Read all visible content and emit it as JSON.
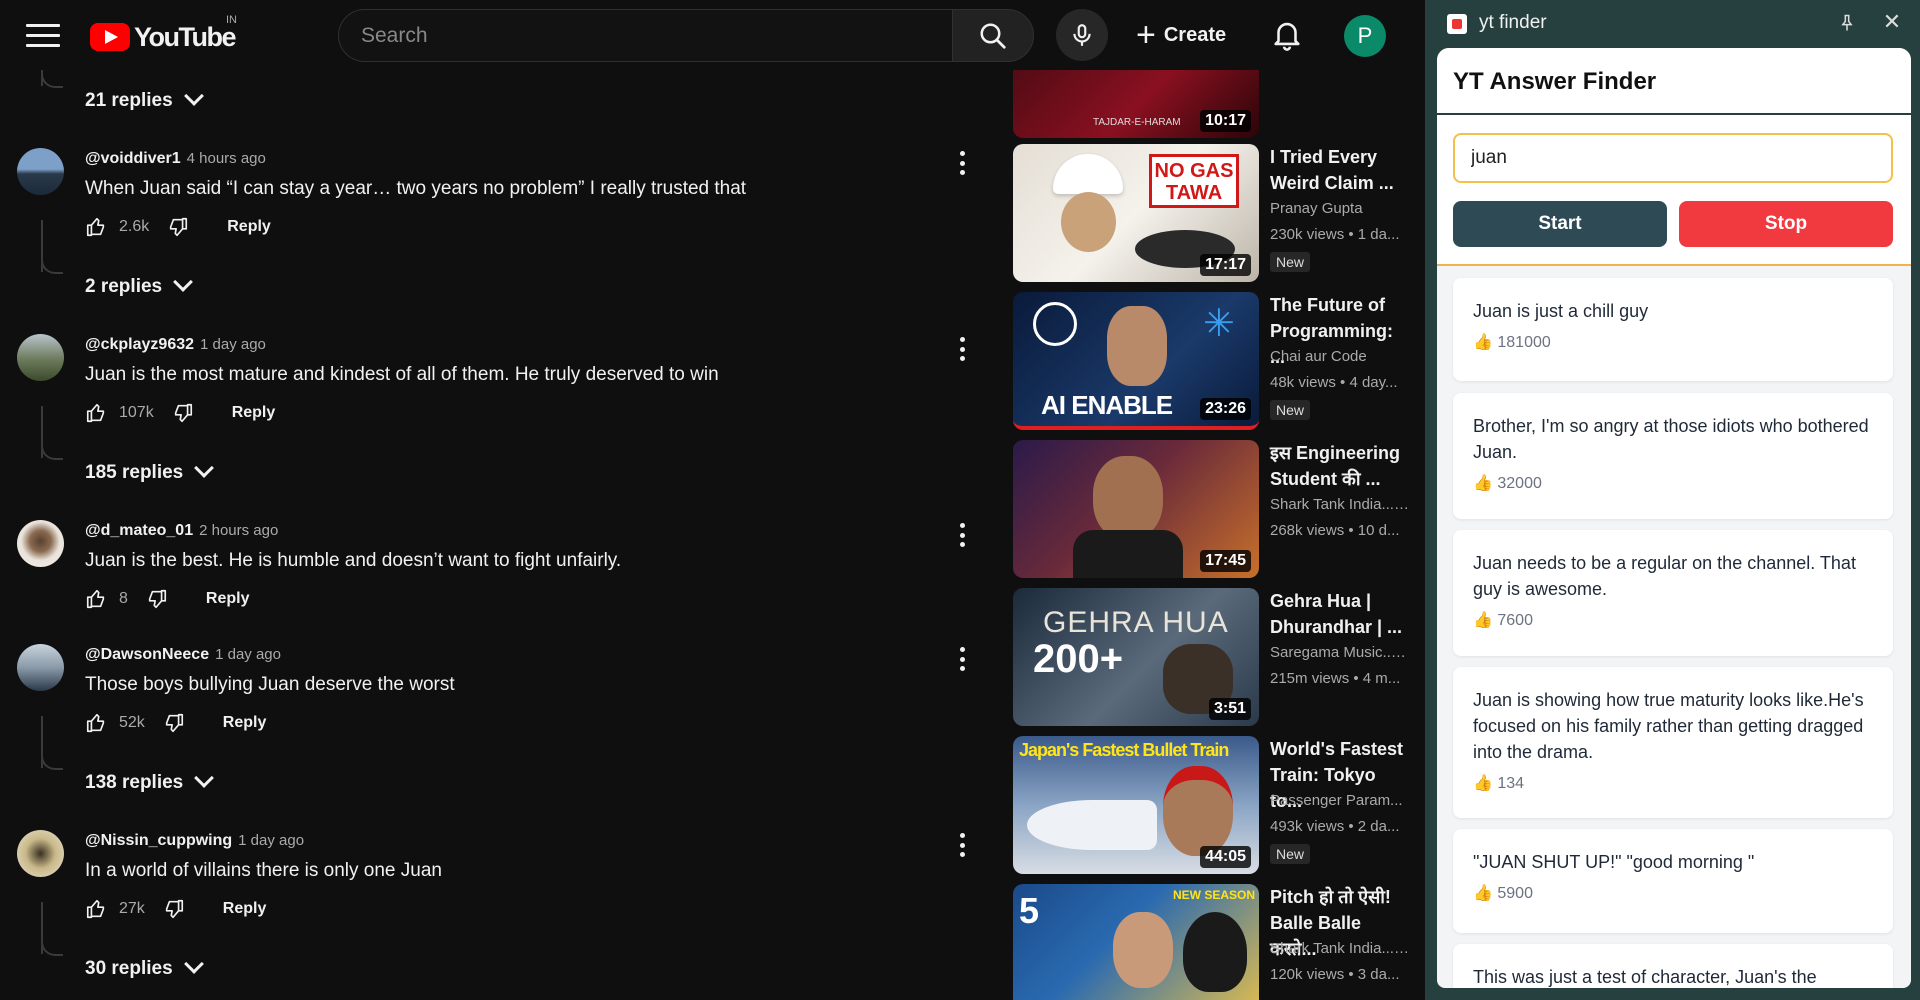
{
  "masthead": {
    "logo_text": "YouTube",
    "country": "IN",
    "search_placeholder": "Search",
    "create_label": "Create",
    "avatar_letter": "P"
  },
  "comments": [
    {
      "author": "@voiddiver1",
      "time": "4 hours ago",
      "text": "When Juan said “I can stay a year… two years no problem” I really trusted that",
      "likes": "2.6k",
      "reply_label": "Reply",
      "replies": "2 replies",
      "avatar_color": "#4a6a8a"
    },
    {
      "author": "@ckplayz9632",
      "time": "1 day ago",
      "text": "Juan is the most mature and kindest of all of them. He truly deserved to win",
      "likes": "107k",
      "reply_label": "Reply",
      "replies": "185 replies",
      "avatar_color": "#6b7a5a"
    },
    {
      "author": "@d_mateo_01",
      "time": "2 hours ago",
      "text": "Juan is the best. He is humble and doesn’t want to fight unfairly.",
      "likes": "8",
      "reply_label": "Reply",
      "replies": "",
      "avatar_color": "#d9cfc4"
    },
    {
      "author": "@DawsonNeece",
      "time": "1 day ago",
      "text": "Those boys bullying Juan deserve the worst",
      "likes": "52k",
      "reply_label": "Reply",
      "replies": "138 replies",
      "avatar_color": "#8a9aa8"
    },
    {
      "author": "@Nissin_cuppwing",
      "time": "1 day ago",
      "text": "In a world of villains there is only one Juan",
      "likes": "27k",
      "reply_label": "Reply",
      "replies": "30 replies",
      "avatar_color": "#c9b98a"
    }
  ],
  "top_replies": "21 replies",
  "recommendations": [
    {
      "title_line1": "",
      "title_line2": "",
      "channel": "",
      "meta": "",
      "badge": "",
      "duration": "10:17",
      "thumb_colors": [
        "#3a0a10",
        "#8a1020"
      ],
      "thumb_text": "TAJDAR-E-HARAM"
    },
    {
      "title_line1": "I Tried Every",
      "title_line2": "Weird Claim ...",
      "channel": "Pranay Gupta",
      "meta": "230k views • 1 da...",
      "badge": "New",
      "duration": "17:17",
      "thumb_colors": [
        "#d8d2c8",
        "#f2efe9"
      ],
      "thumb_text": "NO GAS TAWA"
    },
    {
      "title_line1": "The Future of",
      "title_line2": "Programming: ...",
      "channel": "Chai aur Code",
      "meta": "48k views • 4 day...",
      "badge": "New",
      "duration": "23:26",
      "thumb_colors": [
        "#0a1a3a",
        "#1a3a6a"
      ],
      "thumb_text": "AI ENABLE"
    },
    {
      "title_line1": "इस Engineering",
      "title_line2": "Student की ...",
      "channel": "Shark Tank India...",
      "meta": "268k views • 10 d...",
      "badge": "",
      "duration": "17:45",
      "thumb_colors": [
        "#2a1a4a",
        "#8a3a2a"
      ],
      "thumb_text": ""
    },
    {
      "title_line1": "Gehra Hua |",
      "title_line2": "Dhurandhar | ...",
      "channel": "Saregama Music...",
      "meta": "215m views • 4 m...",
      "badge": "",
      "duration": "3:51",
      "thumb_colors": [
        "#1a2a3a",
        "#6a7a8a"
      ],
      "thumb_text": "GEHRA HUA"
    },
    {
      "title_line1": "World's Fastest",
      "title_line2": "Train: Tokyo to...",
      "channel": "Passenger Param...",
      "meta": "493k views • 2 da...",
      "badge": "New",
      "duration": "44:05",
      "thumb_colors": [
        "#4a6a9a",
        "#c8d4e2"
      ],
      "thumb_text": "Japan's Fastest Bullet Train"
    },
    {
      "title_line1": "Pitch हो तो ऐसी!",
      "title_line2": "Balle Balle करते...",
      "channel": "Shark Tank India...",
      "meta": "120k views • 3 da...",
      "badge": "",
      "duration": "",
      "thumb_colors": [
        "#1a4a8a",
        "#e8c04a"
      ],
      "thumb_text": "NEW SEASON"
    }
  ],
  "extension": {
    "window_title": "yt finder",
    "heading": "YT Answer Finder",
    "query": "juan",
    "start_label": "Start",
    "stop_label": "Stop",
    "results": [
      {
        "text": "Juan is just a chill guy",
        "likes": "👍 181000"
      },
      {
        "text": "Brother, I'm so angry at those idiots who bothered Juan.",
        "likes": "👍 32000"
      },
      {
        "text": "Juan needs to be a regular on the channel. That guy is awesome.",
        "likes": "👍 7600"
      },
      {
        "text": "Juan is showing how true maturity looks like.He's focused on his family rather than getting dragged into the drama.",
        "likes": "👍 134"
      },
      {
        "text": "\"JUAN SHUT UP!\" \"good morning \"",
        "likes": "👍 5900"
      },
      {
        "text": "This was just a test of character, Juan's the",
        "likes": ""
      }
    ]
  }
}
